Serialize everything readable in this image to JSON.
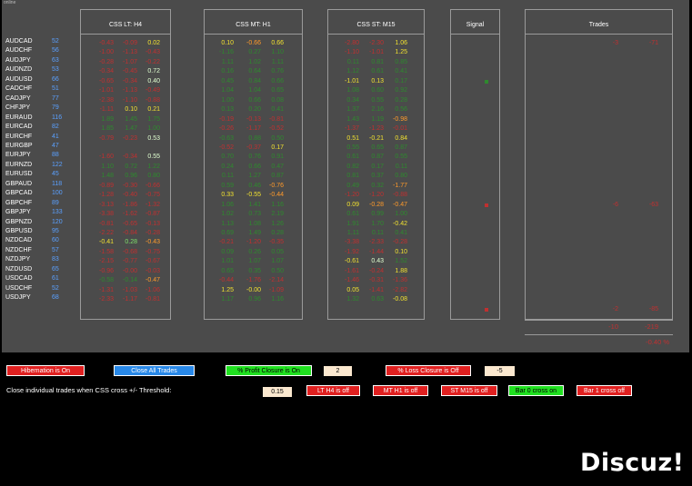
{
  "window_title": "online",
  "pairs": [
    {
      "name": "AUDCAD",
      "value": "52"
    },
    {
      "name": "AUDCHF",
      "value": "56"
    },
    {
      "name": "AUDJPY",
      "value": "63"
    },
    {
      "name": "AUDNZD",
      "value": "53"
    },
    {
      "name": "AUDUSD",
      "value": "66"
    },
    {
      "name": "CADCHF",
      "value": "51"
    },
    {
      "name": "CADJPY",
      "value": "77"
    },
    {
      "name": "CHFJPY",
      "value": "79"
    },
    {
      "name": "EURAUD",
      "value": "116"
    },
    {
      "name": "EURCAD",
      "value": "82"
    },
    {
      "name": "EURCHF",
      "value": "41"
    },
    {
      "name": "EURGBP",
      "value": "47"
    },
    {
      "name": "EURJPY",
      "value": "88"
    },
    {
      "name": "EURNZD",
      "value": "122"
    },
    {
      "name": "EURUSD",
      "value": "45"
    },
    {
      "name": "GBPAUD",
      "value": "118"
    },
    {
      "name": "GBPCAD",
      "value": "100"
    },
    {
      "name": "GBPCHF",
      "value": "89"
    },
    {
      "name": "GBPJPY",
      "value": "133"
    },
    {
      "name": "GBPNZD",
      "value": "120"
    },
    {
      "name": "GBPUSD",
      "value": "95"
    },
    {
      "name": "NZDCAD",
      "value": "60"
    },
    {
      "name": "NZDCHF",
      "value": "57"
    },
    {
      "name": "NZDJPY",
      "value": "83"
    },
    {
      "name": "NZDUSD",
      "value": "65"
    },
    {
      "name": "USDCAD",
      "value": "61"
    },
    {
      "name": "USDCHF",
      "value": "52"
    },
    {
      "name": "USDJPY",
      "value": "68"
    }
  ],
  "css_lt": {
    "title": "CSS LT:   H4",
    "rows": [
      [
        [
          "-0.43",
          "dr"
        ],
        [
          "-0.09",
          "dr"
        ],
        [
          "0.02",
          "y"
        ]
      ],
      [
        [
          "-1.00",
          "dr"
        ],
        [
          "-1.13",
          "dr"
        ],
        [
          "-0.43",
          "dr"
        ]
      ],
      [
        [
          "-0.28",
          "dr"
        ],
        [
          "-1.07",
          "dr"
        ],
        [
          "-0.22",
          "dr"
        ]
      ],
      [
        [
          "-0.34",
          "dr"
        ],
        [
          "-0.45",
          "dr"
        ],
        [
          "0.72",
          "wg"
        ]
      ],
      [
        [
          "-0.65",
          "dr"
        ],
        [
          "-0.34",
          "dr"
        ],
        [
          "0.40",
          "wg"
        ]
      ],
      [
        [
          "-1.01",
          "dr"
        ],
        [
          "-1.13",
          "dr"
        ],
        [
          "-0.49",
          "dr"
        ]
      ],
      [
        [
          "-2.38",
          "dr"
        ],
        [
          "-1.10",
          "dr"
        ],
        [
          "-0.88",
          "dr"
        ]
      ],
      [
        [
          "-1.11",
          "dr"
        ],
        [
          "0.10",
          "y"
        ],
        [
          "0.21",
          "y"
        ]
      ],
      [
        [
          "1.89",
          "dg"
        ],
        [
          "1.45",
          "dg"
        ],
        [
          "1.75",
          "dg"
        ]
      ],
      [
        [
          "1.85",
          "dg"
        ],
        [
          "1.47",
          "dg"
        ],
        [
          "1.00",
          "dg"
        ]
      ],
      [
        [
          "-0.79",
          "dr"
        ],
        [
          "-0.23",
          "dr"
        ],
        [
          "0.53",
          "wg"
        ]
      ],
      [
        [
          "",
          ""
        ],
        [
          "",
          ""
        ],
        [
          "",
          ""
        ]
      ],
      [
        [
          "-1.60",
          "dr"
        ],
        [
          "-0.34",
          "dr"
        ],
        [
          "0.55",
          "wg"
        ]
      ],
      [
        [
          "1.10",
          "dg"
        ],
        [
          "0.72",
          "dg"
        ],
        [
          "1.22",
          "dg"
        ]
      ],
      [
        [
          "1.48",
          "dg"
        ],
        [
          "0.96",
          "dg"
        ],
        [
          "0.80",
          "dg"
        ]
      ],
      [
        [
          "-0.89",
          "dr"
        ],
        [
          "-0.30",
          "dr"
        ],
        [
          "-0.66",
          "dr"
        ]
      ],
      [
        [
          "-1.28",
          "dr"
        ],
        [
          "-0.40",
          "dr"
        ],
        [
          "-0.75",
          "dr"
        ]
      ],
      [
        [
          "-3.13",
          "dr"
        ],
        [
          "-1.86",
          "dr"
        ],
        [
          "-1.32",
          "dr"
        ]
      ],
      [
        [
          "-3.38",
          "dr"
        ],
        [
          "-1.62",
          "dr"
        ],
        [
          "-0.87",
          "dr"
        ]
      ],
      [
        [
          "-0.81",
          "dr"
        ],
        [
          "-0.65",
          "dr"
        ],
        [
          "-0.13",
          "dr"
        ]
      ],
      [
        [
          "-2.22",
          "dr"
        ],
        [
          "-0.84",
          "dr"
        ],
        [
          "-0.28",
          "dr"
        ]
      ],
      [
        [
          "-0.41",
          "y"
        ],
        [
          "0.28",
          "lg"
        ],
        [
          "-0.43",
          "o"
        ]
      ],
      [
        [
          "-1.58",
          "dr"
        ],
        [
          "-0.68",
          "dr"
        ],
        [
          "-0.75",
          "dr"
        ]
      ],
      [
        [
          "-2.15",
          "dr"
        ],
        [
          "-0.77",
          "dr"
        ],
        [
          "-0.67",
          "dr"
        ]
      ],
      [
        [
          "-0.96",
          "dr"
        ],
        [
          "-0.00",
          "dr"
        ],
        [
          "-0.03",
          "dr"
        ]
      ],
      [
        [
          "-0.58",
          "dg"
        ],
        [
          "-0.14",
          "dg"
        ],
        [
          "-0.47",
          "o"
        ]
      ],
      [
        [
          "-1.31",
          "dr"
        ],
        [
          "-1.03",
          "dr"
        ],
        [
          "-1.06",
          "dr"
        ]
      ],
      [
        [
          "-2.33",
          "dr"
        ],
        [
          "-1.17",
          "dr"
        ],
        [
          "-0.81",
          "dr"
        ]
      ]
    ]
  },
  "css_mt": {
    "title": "CSS MT:   H1",
    "rows": [
      [
        [
          "0.10",
          "y"
        ],
        [
          "-0.66",
          "o"
        ],
        [
          "0.66",
          "y"
        ]
      ],
      [
        [
          "-1.16",
          "dg"
        ],
        [
          "0.27",
          "dg"
        ],
        [
          "1.10",
          "dg"
        ]
      ],
      [
        [
          "1.11",
          "dg"
        ],
        [
          "1.02",
          "dg"
        ],
        [
          "1.11",
          "dg"
        ]
      ],
      [
        [
          "0.16",
          "dg"
        ],
        [
          "0.64",
          "dg"
        ],
        [
          "0.76",
          "dg"
        ]
      ],
      [
        [
          "0.45",
          "dg"
        ],
        [
          "0.84",
          "dg"
        ],
        [
          "0.66",
          "dg"
        ]
      ],
      [
        [
          "1.04",
          "dg"
        ],
        [
          "1.04",
          "dg"
        ],
        [
          "0.65",
          "dg"
        ]
      ],
      [
        [
          "1.00",
          "dg"
        ],
        [
          "0.66",
          "dg"
        ],
        [
          "0.08",
          "dg"
        ]
      ],
      [
        [
          "0.13",
          "dg"
        ],
        [
          "0.20",
          "dg"
        ],
        [
          "0.41",
          "dg"
        ]
      ],
      [
        [
          "-0.19",
          "dr"
        ],
        [
          "-0.13",
          "dr"
        ],
        [
          "-0.81",
          "dr"
        ]
      ],
      [
        [
          "-0.26",
          "dr"
        ],
        [
          "-1.17",
          "dr"
        ],
        [
          "-0.52",
          "dr"
        ]
      ],
      [
        [
          "-0.63",
          "dg"
        ],
        [
          "0.88",
          "dg"
        ],
        [
          "0.50",
          "dg"
        ]
      ],
      [
        [
          "-0.52",
          "dr"
        ],
        [
          "-0.37",
          "dr"
        ],
        [
          "0.17",
          "y"
        ]
      ],
      [
        [
          "0.70",
          "dg"
        ],
        [
          "0.76",
          "dg"
        ],
        [
          "0.91",
          "dg"
        ]
      ],
      [
        [
          "0.24",
          "dg"
        ],
        [
          "0.66",
          "dg"
        ],
        [
          "0.47",
          "dg"
        ]
      ],
      [
        [
          "0.11",
          "dg"
        ],
        [
          "1.27",
          "dg"
        ],
        [
          "0.87",
          "dg"
        ]
      ],
      [
        [
          "0.59",
          "dg"
        ],
        [
          "0.46",
          "dg"
        ],
        [
          "-0.76",
          "o"
        ]
      ],
      [
        [
          "0.33",
          "y"
        ],
        [
          "-0.55",
          "y"
        ],
        [
          "-0.44",
          "o"
        ]
      ],
      [
        [
          "1.06",
          "dg"
        ],
        [
          "1.41",
          "dg"
        ],
        [
          "1.16",
          "dg"
        ]
      ],
      [
        [
          "1.02",
          "dg"
        ],
        [
          "0.73",
          "dg"
        ],
        [
          "2.19",
          "dg"
        ]
      ],
      [
        [
          "1.13",
          "dg"
        ],
        [
          "1.08",
          "dg"
        ],
        [
          "1.26",
          "dg"
        ]
      ],
      [
        [
          "0.69",
          "dg"
        ],
        [
          "1.49",
          "dg"
        ],
        [
          "0.28",
          "dg"
        ]
      ],
      [
        [
          "-0.21",
          "dr"
        ],
        [
          "-1.20",
          "dr"
        ],
        [
          "-0.35",
          "dr"
        ]
      ],
      [
        [
          "0.09",
          "dg"
        ],
        [
          "0.26",
          "dg"
        ],
        [
          "0.05",
          "dg"
        ]
      ],
      [
        [
          "1.01",
          "dg"
        ],
        [
          "1.07",
          "dg"
        ],
        [
          "1.07",
          "dg"
        ]
      ],
      [
        [
          "0.65",
          "dg"
        ],
        [
          "0.35",
          "dg"
        ],
        [
          "0.50",
          "dg"
        ]
      ],
      [
        [
          "-0.44",
          "dr"
        ],
        [
          "-1.76",
          "dr"
        ],
        [
          "-2.14",
          "dr"
        ]
      ],
      [
        [
          "1.25",
          "y"
        ],
        [
          "-0.00",
          "y"
        ],
        [
          "-1.09",
          "dr"
        ]
      ],
      [
        [
          "1.17",
          "dg"
        ],
        [
          "0.96",
          "dg"
        ],
        [
          "1.16",
          "dg"
        ]
      ]
    ]
  },
  "css_st": {
    "title": "CSS ST:   M15",
    "rows": [
      [
        [
          "-2.80",
          "dr"
        ],
        [
          "-2.30",
          "dr"
        ],
        [
          "1.06",
          "y"
        ]
      ],
      [
        [
          "-1.10",
          "dr"
        ],
        [
          "-1.01",
          "dr"
        ],
        [
          "1.25",
          "y"
        ]
      ],
      [
        [
          "0.11",
          "dg"
        ],
        [
          "0.81",
          "dg"
        ],
        [
          "0.85",
          "dg"
        ]
      ],
      [
        [
          "1.12",
          "dg"
        ],
        [
          "0.61",
          "dg"
        ],
        [
          "0.41",
          "dg"
        ]
      ],
      [
        [
          "-1.01",
          "y"
        ],
        [
          "0.13",
          "y"
        ],
        [
          "0.17",
          "dg"
        ]
      ],
      [
        [
          "1.08",
          "dg"
        ],
        [
          "0.60",
          "dg"
        ],
        [
          "0.92",
          "dg"
        ]
      ],
      [
        [
          "0.34",
          "dg"
        ],
        [
          "0.55",
          "dg"
        ],
        [
          "0.28",
          "dg"
        ]
      ],
      [
        [
          "1.37",
          "dg"
        ],
        [
          "2.16",
          "dg"
        ],
        [
          "0.56",
          "dg"
        ]
      ],
      [
        [
          "1.43",
          "dg"
        ],
        [
          "1.19",
          "dg"
        ],
        [
          "-0.98",
          "o"
        ]
      ],
      [
        [
          "-1.37",
          "dr"
        ],
        [
          "-1.23",
          "dr"
        ],
        [
          "-0.01",
          "dr"
        ]
      ],
      [
        [
          "0.51",
          "y"
        ],
        [
          "-0.21",
          "y"
        ],
        [
          "0.84",
          "y"
        ]
      ],
      [
        [
          "0.55",
          "dg"
        ],
        [
          "0.65",
          "dg"
        ],
        [
          "0.87",
          "dg"
        ]
      ],
      [
        [
          "0.61",
          "dg"
        ],
        [
          "0.87",
          "dg"
        ],
        [
          "0.55",
          "dg"
        ]
      ],
      [
        [
          "0.82",
          "dg"
        ],
        [
          "0.17",
          "dg"
        ],
        [
          "0.11",
          "dg"
        ]
      ],
      [
        [
          "0.81",
          "dg"
        ],
        [
          "0.37",
          "dg"
        ],
        [
          "0.80",
          "dg"
        ]
      ],
      [
        [
          "0.49",
          "dg"
        ],
        [
          "0.32",
          "dg"
        ],
        [
          "-1.77",
          "o"
        ]
      ],
      [
        [
          "-1.20",
          "dr"
        ],
        [
          "-1.20",
          "dr"
        ],
        [
          "-0.88",
          "dr"
        ]
      ],
      [
        [
          "0.09",
          "y"
        ],
        [
          "-0.28",
          "o"
        ],
        [
          "-0.47",
          "o"
        ]
      ],
      [
        [
          "0.61",
          "dg"
        ],
        [
          "0.99",
          "dg"
        ],
        [
          "1.00",
          "dg"
        ]
      ],
      [
        [
          "1.91",
          "dg"
        ],
        [
          "1.70",
          "dg"
        ],
        [
          "-0.42",
          "y"
        ]
      ],
      [
        [
          "1.11",
          "dg"
        ],
        [
          "0.11",
          "dg"
        ],
        [
          "0.41",
          "dg"
        ]
      ],
      [
        [
          "-3.38",
          "dr"
        ],
        [
          "-2.33",
          "dr"
        ],
        [
          "-0.28",
          "dr"
        ]
      ],
      [
        [
          "-1.92",
          "dr"
        ],
        [
          "-1.44",
          "dr"
        ],
        [
          "0.10",
          "y"
        ]
      ],
      [
        [
          "-0.61",
          "y"
        ],
        [
          "0.43",
          "wg"
        ],
        [
          "1.52",
          "dg"
        ]
      ],
      [
        [
          "-1.61",
          "dr"
        ],
        [
          "-0.24",
          "dr"
        ],
        [
          "1.88",
          "y"
        ]
      ],
      [
        [
          "-1.46",
          "dr"
        ],
        [
          "-0.31",
          "dr"
        ],
        [
          "-1.36",
          "dr"
        ]
      ],
      [
        [
          "0.05",
          "y"
        ],
        [
          "-1.41",
          "dr"
        ],
        [
          "-2.82",
          "dr"
        ]
      ],
      [
        [
          "1.32",
          "dg"
        ],
        [
          "0.63",
          "dg"
        ],
        [
          "-0.08",
          "y"
        ]
      ]
    ]
  },
  "signal": {
    "title": "Signal",
    "marks": [
      {
        "row": 4,
        "color": "#2e8a2e"
      },
      {
        "row": 17,
        "color": "#c03030"
      },
      {
        "row": 28,
        "color": "#c03030"
      }
    ]
  },
  "trades": {
    "title": "Trades",
    "entries": [
      {
        "row": 0,
        "lots": "-3",
        "pips": "-71"
      },
      {
        "row": 17,
        "lots": "-6",
        "pips": "-63"
      },
      {
        "row": 28,
        "lots": "-2",
        "pips": "-85"
      }
    ],
    "total_lots": "-10",
    "total_pips": "-219",
    "percent": "-0.40 %"
  },
  "controls": {
    "hibernation": "Hibernation is On",
    "close_all": "Close All Trades",
    "profit_closure": "% Profit Closure is On",
    "profit_value": "2",
    "loss_closure": "% Loss Closure is Off",
    "loss_value": "-5",
    "close_individual_label": "Close individual trades when CSS cross +/- Threshold:",
    "threshold_value": "0.15",
    "lt_button": "LT  H4 is off",
    "mt_button": "MT  H1 is off",
    "st_button": "ST  M15 is off",
    "bar0_button": "Bar 0 cross on",
    "bar1_button": "Bar 1 cross off"
  },
  "logo_text": "Discuz!"
}
